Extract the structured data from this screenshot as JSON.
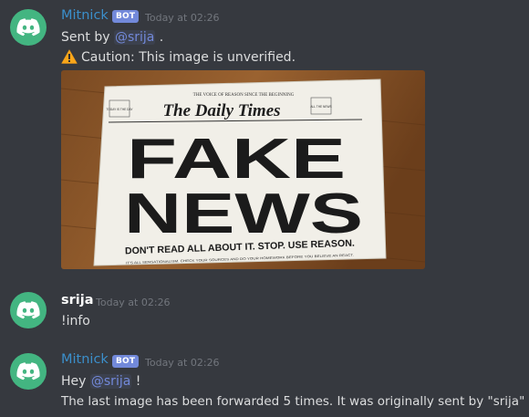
{
  "messages": [
    {
      "author": "Mitnick",
      "badge": "BOT",
      "timestamp": "Today at 02:26",
      "line1_prefix": "Sent by ",
      "line1_mention": "@srija",
      "line1_suffix": " .",
      "caution_text": "Caution: This image is unverified.",
      "image": {
        "banner_top": "THE VOICE OF REASON SINCE THE BEGINNING",
        "masthead": "The Daily Times",
        "left_box": "TODAY IS THE DAY",
        "right_box": "ALL THE NEWS",
        "headline_1": "FAKE",
        "headline_2": "NEWS",
        "subhead": "DON'T READ ALL ABOUT IT. STOP. USE REASON.",
        "footer": "IT'S ALL SENSATIONALISM. CHECK YOUR SOURCES AND DO YOUR HOMEWORK BEFORE YOU BELIEVE AN REACT."
      }
    },
    {
      "author": "srija",
      "timestamp": "Today at 02:26",
      "text": "!info"
    },
    {
      "author": "Mitnick",
      "badge": "BOT",
      "timestamp": "Today at 02:26",
      "line1_prefix": "Hey ",
      "line1_mention": "@srija",
      "line1_suffix": " !",
      "line2": "The last image has been forwarded 5 times. It was originally sent by \"srija\""
    }
  ],
  "colors": {
    "background": "#36393f",
    "avatar": "#43b581",
    "bot_name": "#3b8fcb",
    "badge": "#7289da",
    "mention": "#7289da",
    "timestamp": "#72767d"
  },
  "icons": {
    "avatar": "discord-logo-icon",
    "caution": "warning-icon"
  }
}
